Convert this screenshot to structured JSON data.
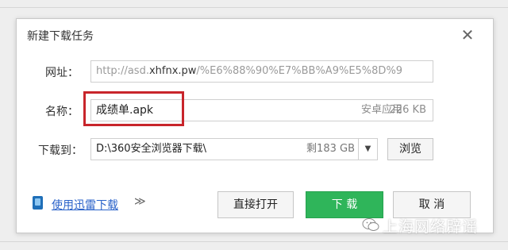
{
  "dialog": {
    "title": "新建下载任务",
    "close_glyph": "✕"
  },
  "url": {
    "label": "网址：",
    "prefix": "http://asd.",
    "domain": "xhfnx.pw",
    "rest": "/%E6%88%90%E7%BB%A9%E5%8D%9"
  },
  "name": {
    "label": "名称：",
    "value": "成绩单.apk",
    "type": "安卓应用",
    "size": "226 KB"
  },
  "save_to": {
    "label": "下载到：",
    "path": "D:\\360安全浏览器下载\\",
    "free_space": "剩183 GB",
    "browse_label": "浏览"
  },
  "footer": {
    "xunlei_link": "使用迅雷下载",
    "more_glyph": "≫",
    "open_label": "直接打开",
    "download_label": "下 载",
    "cancel_label": "取 消"
  },
  "watermark": {
    "text": "上海网络辟谣"
  },
  "colors": {
    "primary_button": "#2fb55a",
    "highlight_box": "#c8252b",
    "link": "#2a62c9"
  },
  "icons": [
    "close-icon",
    "xunlei-icon",
    "chevron-down-icon",
    "double-chevron-icon",
    "wechat-icon"
  ]
}
